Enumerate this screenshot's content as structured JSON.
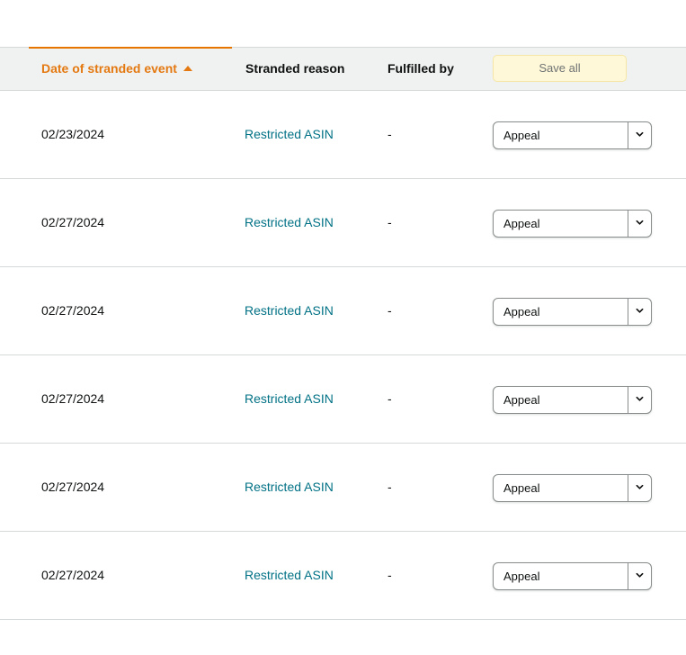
{
  "table": {
    "headers": {
      "date": "Date of stranded event",
      "reason": "Stranded reason",
      "fulfilled": "Fulfilled by",
      "save_all": "Save all"
    },
    "rows": [
      {
        "date": "02/23/2024",
        "reason": "Restricted ASIN",
        "fulfilled": "-",
        "action": "Appeal"
      },
      {
        "date": "02/27/2024",
        "reason": "Restricted ASIN",
        "fulfilled": "-",
        "action": "Appeal"
      },
      {
        "date": "02/27/2024",
        "reason": "Restricted ASIN",
        "fulfilled": "-",
        "action": "Appeal"
      },
      {
        "date": "02/27/2024",
        "reason": "Restricted ASIN",
        "fulfilled": "-",
        "action": "Appeal"
      },
      {
        "date": "02/27/2024",
        "reason": "Restricted ASIN",
        "fulfilled": "-",
        "action": "Appeal"
      },
      {
        "date": "02/27/2024",
        "reason": "Restricted ASIN",
        "fulfilled": "-",
        "action": "Appeal"
      }
    ]
  },
  "colors": {
    "sort_accent": "#e47911",
    "link": "#007185",
    "save_all_bg": "#fff8d8",
    "header_bg": "#f0f2f2"
  },
  "icons": {
    "sort": "caret-up-icon",
    "dropdown": "chevron-down-icon"
  }
}
